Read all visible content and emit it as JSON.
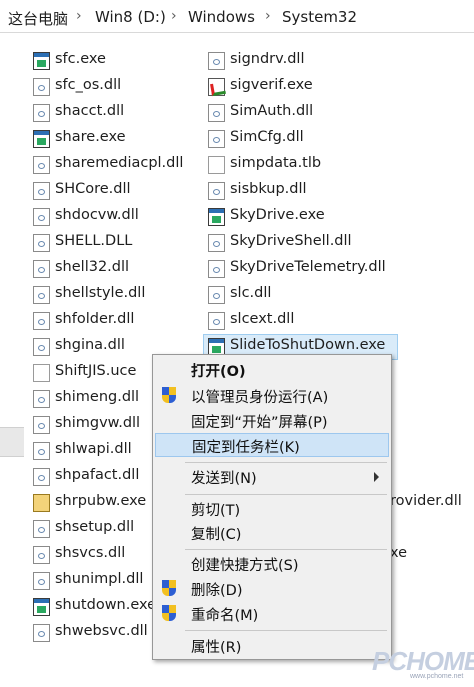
{
  "breadcrumb": {
    "items": [
      "这台电脑",
      "Win8 (D:)",
      "Windows",
      "System32"
    ],
    "separator": "›"
  },
  "files_left": [
    {
      "name": "sfc.exe",
      "icon": "exe-icon"
    },
    {
      "name": "sfc_os.dll",
      "icon": "dll-icon"
    },
    {
      "name": "shacct.dll",
      "icon": "dll-icon"
    },
    {
      "name": "share.exe",
      "icon": "exe-icon"
    },
    {
      "name": "sharemediacpl.dll",
      "icon": "dll-icon"
    },
    {
      "name": "SHCore.dll",
      "icon": "dll-icon"
    },
    {
      "name": "shdocvw.dll",
      "icon": "dll-icon"
    },
    {
      "name": "SHELL.DLL",
      "icon": "dll-icon"
    },
    {
      "name": "shell32.dll",
      "icon": "dll-icon"
    },
    {
      "name": "shellstyle.dll",
      "icon": "dll-icon"
    },
    {
      "name": "shfolder.dll",
      "icon": "dll-icon"
    },
    {
      "name": "shgina.dll",
      "icon": "dll-icon"
    },
    {
      "name": "ShiftJIS.uce",
      "icon": "file-icon"
    },
    {
      "name": "shimeng.dll",
      "icon": "dll-icon"
    },
    {
      "name": "shimgvw.dll",
      "icon": "dll-icon"
    },
    {
      "name": "shlwapi.dll",
      "icon": "dll-icon"
    },
    {
      "name": "shpafact.dll",
      "icon": "dll-icon"
    },
    {
      "name": "shrpubw.exe",
      "icon": "publish-exe-icon"
    },
    {
      "name": "shsetup.dll",
      "icon": "dll-icon"
    },
    {
      "name": "shsvcs.dll",
      "icon": "dll-icon"
    },
    {
      "name": "shunimpl.dll",
      "icon": "dll-icon"
    },
    {
      "name": "shutdown.exe",
      "icon": "exe-icon"
    },
    {
      "name": "shwebsvc.dll",
      "icon": "dll-icon"
    }
  ],
  "files_right": [
    {
      "name": "signdrv.dll",
      "icon": "dll-icon"
    },
    {
      "name": "sigverif.exe",
      "icon": "sigverif-icon"
    },
    {
      "name": "SimAuth.dll",
      "icon": "dll-icon"
    },
    {
      "name": "SimCfg.dll",
      "icon": "dll-icon"
    },
    {
      "name": "simpdata.tlb",
      "icon": "file-icon"
    },
    {
      "name": "sisbkup.dll",
      "icon": "dll-icon"
    },
    {
      "name": "SkyDrive.exe",
      "icon": "exe-icon"
    },
    {
      "name": "SkyDriveShell.dll",
      "icon": "dll-icon"
    },
    {
      "name": "SkyDriveTelemetry.dll",
      "icon": "dll-icon"
    },
    {
      "name": "slc.dll",
      "icon": "dll-icon"
    },
    {
      "name": "slcext.dll",
      "icon": "dll-icon"
    },
    {
      "name": "SlideToShutDown.exe",
      "icon": "exe-icon",
      "selected": true
    }
  ],
  "files_right_partial": [
    {
      "name": "rovider.dll"
    },
    {
      "name": "xe"
    }
  ],
  "context_menu": {
    "items": [
      {
        "label": "打开(O)",
        "bold": true
      },
      {
        "label": "以管理员身份运行(A)",
        "shield": true
      },
      {
        "label": "固定到“开始”屏幕(P)"
      },
      {
        "label": "固定到任务栏(K)",
        "highlighted": true
      },
      {
        "label": "发送到(N)",
        "submenu": true
      },
      {
        "label": "剪切(T)"
      },
      {
        "label": "复制(C)"
      },
      {
        "label": "创建快捷方式(S)"
      },
      {
        "label": "删除(D)",
        "shield": true
      },
      {
        "label": "重命名(M)",
        "shield": true
      },
      {
        "label": "属性(R)"
      }
    ]
  },
  "watermark": {
    "big": "PCHOME",
    "small": "www.pchome.net"
  },
  "colors": {
    "selection": "#d9ebf9",
    "menu_bg": "#f0f0f0",
    "menu_highlight": "#cfe4f7"
  }
}
